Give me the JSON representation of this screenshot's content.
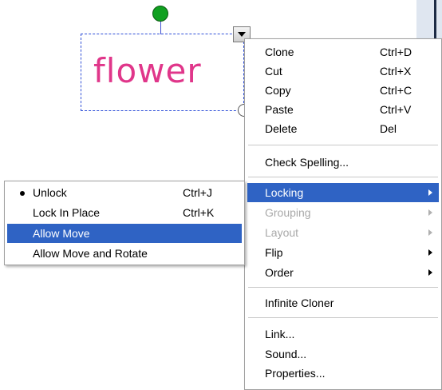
{
  "canvas_object": {
    "text": "flower"
  },
  "context_menu": {
    "items": [
      {
        "label": "Clone",
        "shortcut": "Ctrl+D"
      },
      {
        "label": "Cut",
        "shortcut": "Ctrl+X"
      },
      {
        "label": "Copy",
        "shortcut": "Ctrl+C"
      },
      {
        "label": "Paste",
        "shortcut": "Ctrl+V"
      },
      {
        "label": "Delete",
        "shortcut": "Del"
      },
      {
        "label": "Check Spelling..."
      },
      {
        "label": "Locking",
        "state": "highlighted",
        "submenu": true
      },
      {
        "label": "Grouping",
        "state": "disabled",
        "submenu": true
      },
      {
        "label": "Layout",
        "state": "disabled",
        "submenu": true
      },
      {
        "label": "Flip",
        "submenu": true
      },
      {
        "label": "Order",
        "submenu": true
      },
      {
        "label": "Infinite Cloner"
      },
      {
        "label": "Link..."
      },
      {
        "label": "Sound..."
      },
      {
        "label": "Properties..."
      }
    ]
  },
  "locking_submenu": {
    "items": [
      {
        "label": "Unlock",
        "shortcut": "Ctrl+J",
        "checked": true
      },
      {
        "label": "Lock In Place",
        "shortcut": "Ctrl+K"
      },
      {
        "label": "Allow Move",
        "state": "highlighted"
      },
      {
        "label": "Allow Move and Rotate"
      }
    ]
  },
  "colors": {
    "highlight": "#2f63c4",
    "text_object": "#e0368a",
    "rotate_handle": "#10a020",
    "disabled_text": "#a8a8a8"
  },
  "icons": [
    "rotate-handle-icon",
    "menu-dropdown-icon",
    "resize-handle-icon",
    "submenu-arrow-icon",
    "radio-bullet-icon"
  ]
}
